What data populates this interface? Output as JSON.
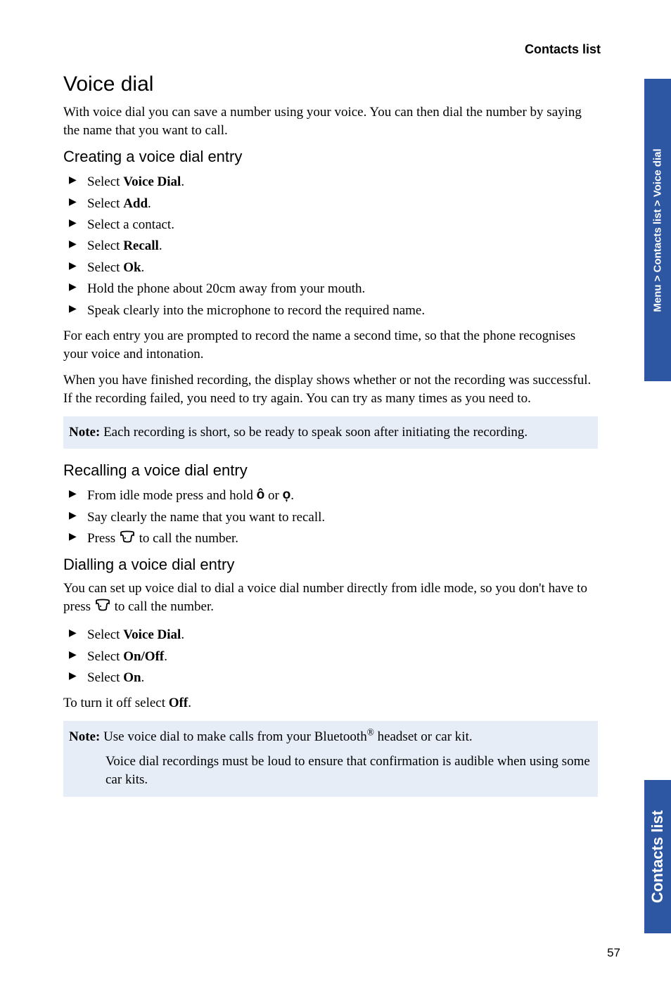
{
  "header": {
    "section": "Contacts list"
  },
  "h1": "Voice dial",
  "intro": "With voice dial you can save a number using your voice. You can then dial the number by saying the name that you want to call.",
  "creating": {
    "heading": "Creating a voice dial entry",
    "items": [
      {
        "pre": "Select ",
        "bold": "Voice Dial",
        "post": "."
      },
      {
        "pre": "Select ",
        "bold": "Add",
        "post": "."
      },
      {
        "pre": "Select a contact.",
        "bold": "",
        "post": ""
      },
      {
        "pre": "Select ",
        "bold": "Recall",
        "post": "."
      },
      {
        "pre": "Select ",
        "bold": "Ok",
        "post": "."
      },
      {
        "pre": "Hold the phone about 20cm away from your mouth.",
        "bold": "",
        "post": ""
      },
      {
        "pre": "Speak clearly into the microphone to record the required name.",
        "bold": "",
        "post": ""
      }
    ],
    "para1": "For each entry you are prompted to record the name a second time, so that the phone recognises your voice and intonation.",
    "para2": "When you have finished recording, the display shows whether or not the recording was successful. If the recording failed, you need to try again. You can try as many times as you need to."
  },
  "note1": {
    "label": "Note:",
    "text": " Each recording is short, so be ready to speak soon after initiating the recording."
  },
  "recalling": {
    "heading": "Recalling a voice dial entry",
    "item1_pre": "From idle mode press and hold ",
    "item1_or": " or ",
    "item1_post": ".",
    "item2": "Say clearly the name that you want to recall.",
    "item3_pre": "Press ",
    "item3_post": " to call the number."
  },
  "dialling": {
    "heading": "Dialling a voice dial entry",
    "para_pre": "You can set up voice dial to dial a voice dial number directly from idle mode, so you don't have to press ",
    "para_post": " to call the number.",
    "items": [
      {
        "pre": "Select ",
        "bold": "Voice Dial",
        "post": "."
      },
      {
        "pre": "Select ",
        "bold": "On/Off",
        "post": "."
      },
      {
        "pre": "Select ",
        "bold": "On",
        "post": "."
      }
    ],
    "off_pre": "To turn it off select ",
    "off_bold": "Off",
    "off_post": "."
  },
  "note2": {
    "label": "Note:",
    "line1_pre": " Use voice dial to make calls from your Bluetooth",
    "line1_sup": "®",
    "line1_post": " headset or car kit.",
    "line2": "Voice dial recordings must be loud to ensure that confirmation is audible when using some car kits."
  },
  "sidetab": {
    "top": "Menu > Contacts list > Voice dial",
    "bottom": "Contacts list"
  },
  "icons": {
    "memo1": "ô",
    "memo2": "o̦"
  },
  "pagenum": "57"
}
